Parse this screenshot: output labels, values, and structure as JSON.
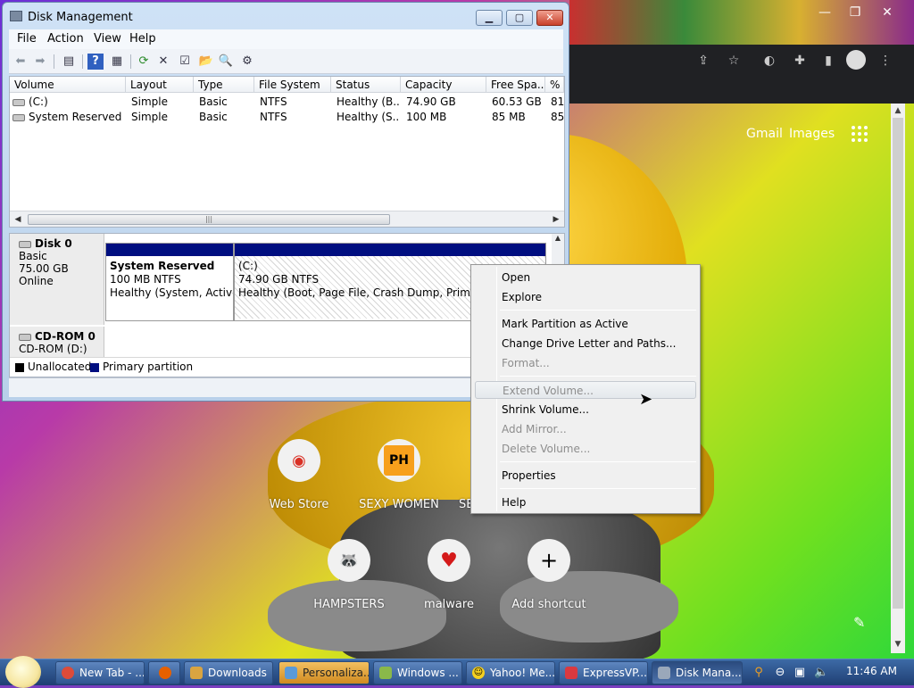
{
  "colors": {
    "primary_partition": "#000e80",
    "unallocated": "#000000",
    "menu_bg": "#f0f0f0"
  },
  "chrome": {
    "gmail": "Gmail",
    "images": "Images",
    "shortcuts": [
      {
        "label": "Web Store",
        "icon": "chrome-store-icon"
      },
      {
        "label": "SEXY WOMEN",
        "icon": "ph-icon",
        "badge": "PH"
      },
      {
        "label": "SE",
        "icon": "partial-icon"
      },
      {
        "label": "HAMPSTERS",
        "icon": "raccoon-icon"
      },
      {
        "label": "malware",
        "icon": "heart-icon"
      },
      {
        "label": "Add shortcut",
        "icon": "plus-icon"
      }
    ]
  },
  "dm": {
    "title": "Disk Management",
    "menu": [
      "File",
      "Action",
      "View",
      "Help"
    ],
    "columns": [
      "Volume",
      "Layout",
      "Type",
      "File System",
      "Status",
      "Capacity",
      "Free Spa...",
      "% F"
    ],
    "rows": [
      {
        "volume": "(C:)",
        "layout": "Simple",
        "type": "Basic",
        "fs": "NTFS",
        "status": "Healthy (B...",
        "capacity": "74.90 GB",
        "free": "60.53 GB",
        "pct": "81"
      },
      {
        "volume": "System Reserved",
        "layout": "Simple",
        "type": "Basic",
        "fs": "NTFS",
        "status": "Healthy (S...",
        "capacity": "100 MB",
        "free": "85 MB",
        "pct": "85"
      }
    ],
    "disk0": {
      "name": "Disk 0",
      "kind": "Basic",
      "size": "75.00 GB",
      "state": "Online",
      "p1": {
        "name": "System Reserved",
        "size": "100 MB NTFS",
        "status": "Healthy (System, Active,"
      },
      "p2": {
        "name": "(C:)",
        "size": "74.90 GB NTFS",
        "status": "Healthy (Boot, Page File, Crash Dump, Primary Pa"
      }
    },
    "cdrom": {
      "name": "CD-ROM 0",
      "sub": "CD-ROM (D:)"
    },
    "legend": {
      "unallocated": "Unallocated",
      "primary": "Primary partition"
    }
  },
  "context_menu": {
    "open": "Open",
    "explore": "Explore",
    "mark_active": "Mark Partition as Active",
    "change_letter": "Change Drive Letter and Paths...",
    "format": "Format...",
    "extend": "Extend Volume...",
    "shrink": "Shrink Volume...",
    "add_mirror": "Add Mirror...",
    "delete": "Delete Volume...",
    "properties": "Properties",
    "help": "Help"
  },
  "taskbar": {
    "items": [
      "New Tab - ...",
      "Downloads",
      "Personaliza...",
      "Windows ...",
      "Yahoo! Me...",
      "ExpressVP...",
      "Disk Mana..."
    ],
    "clock": "11:46 AM"
  }
}
